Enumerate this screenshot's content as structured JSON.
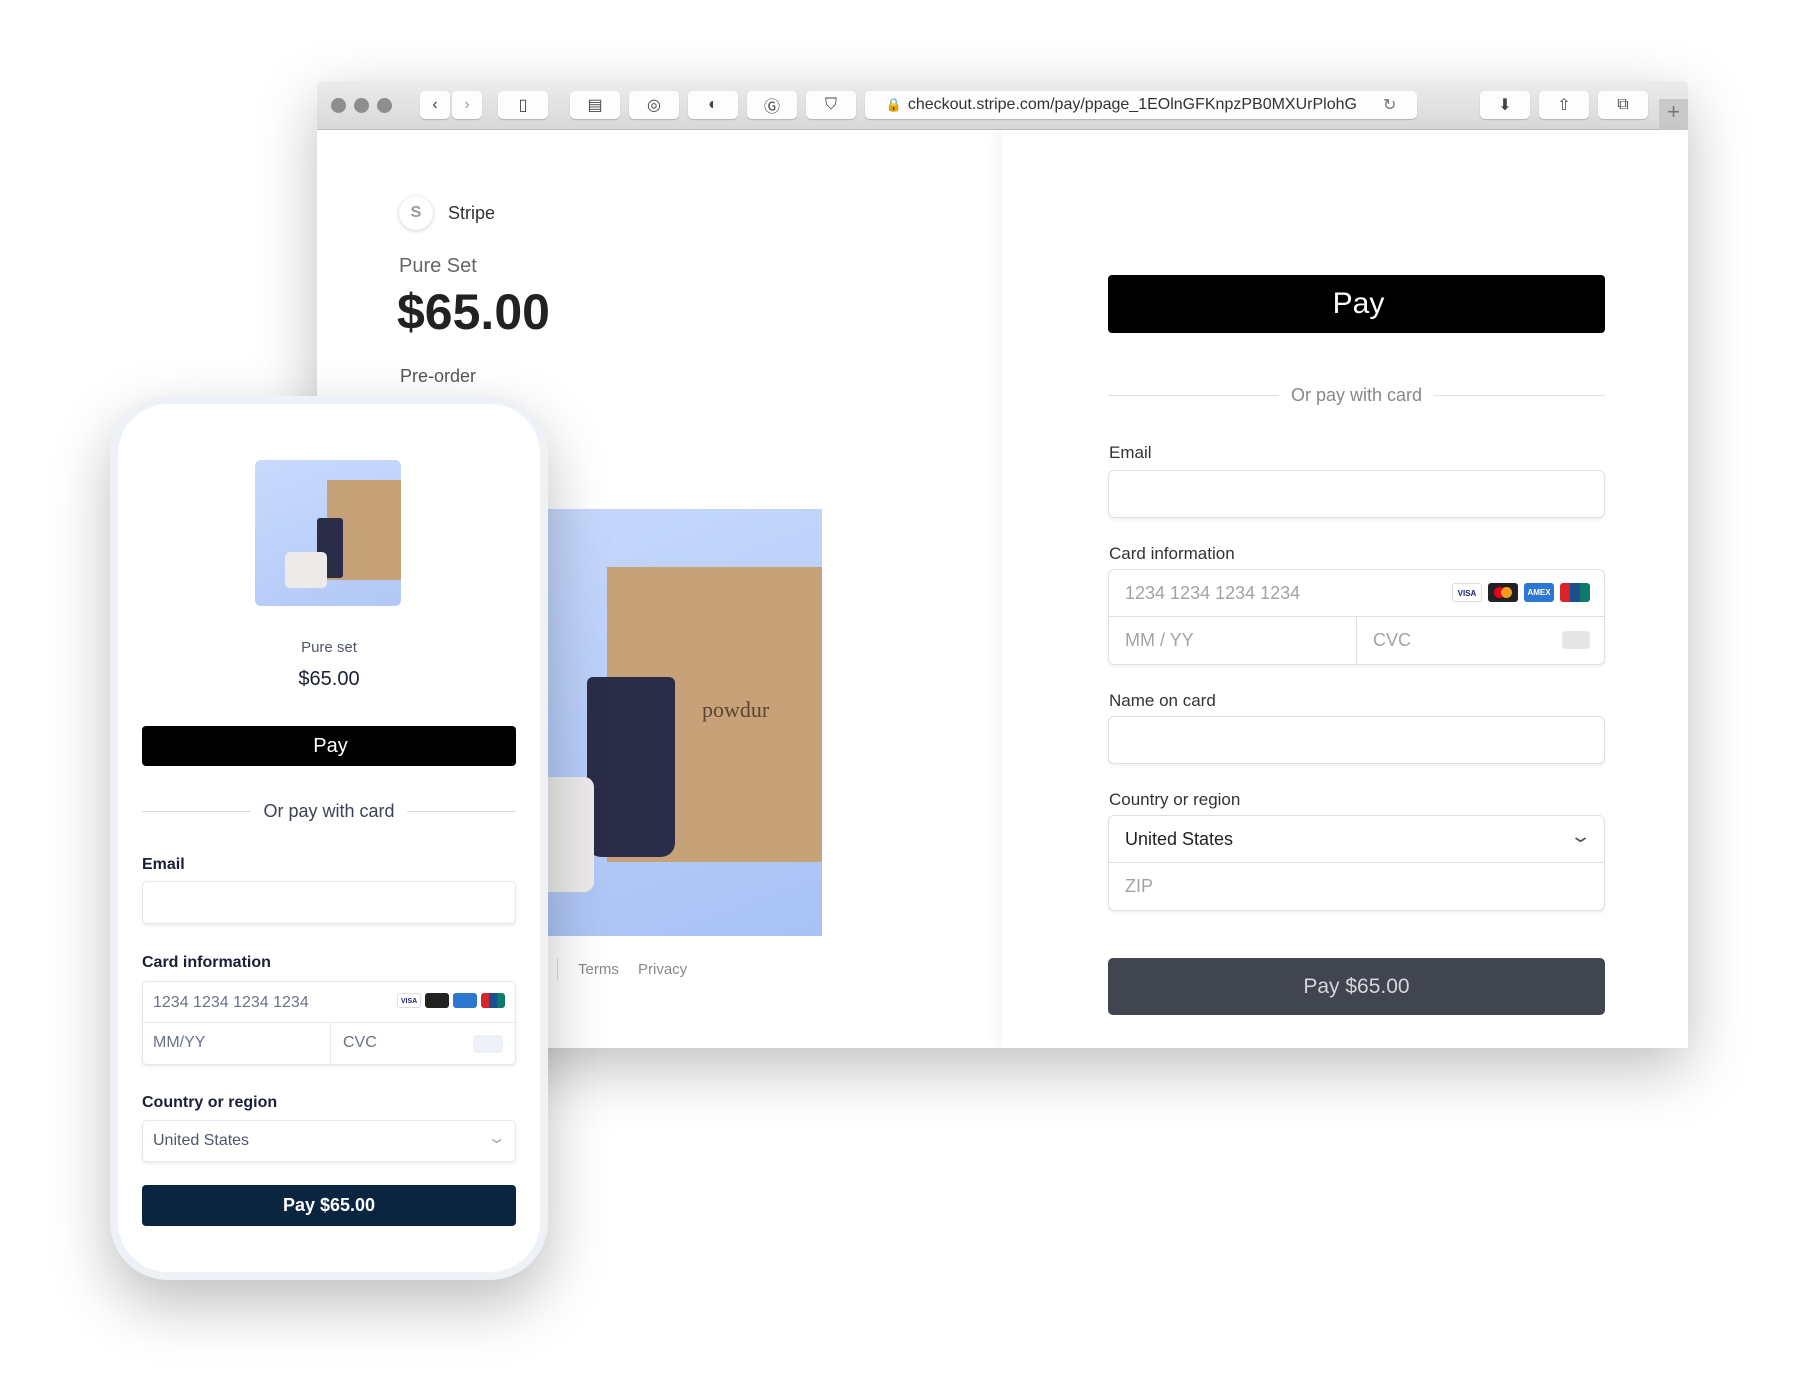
{
  "browser": {
    "url": "checkout.stripe.com/pay/ppage_1EOlnGFKnpzPB0MXUrPlohG",
    "toolbar_icons": [
      "back-icon",
      "forward-icon",
      "sidebar-icon",
      "extension-icon",
      "onepassword-icon",
      "toggle-icon",
      "grammarly-icon",
      "pocket-icon",
      "download-icon",
      "share-icon",
      "tabs-icon",
      "new-tab-icon"
    ]
  },
  "desktop": {
    "brand": "Stripe",
    "product_name": "Pure Set",
    "price": "$65.00",
    "subtitle": "Pre-order",
    "product_image_text": "powdur",
    "footer_links": [
      "Terms",
      "Privacy"
    ],
    "apple_pay_label": "Pay",
    "divider_text": "Or pay with card",
    "email_label": "Email",
    "card_label": "Card information",
    "card_number_placeholder": "1234 1234 1234 1234",
    "expiry_placeholder": "MM / YY",
    "cvc_placeholder": "CVC",
    "name_label": "Name on card",
    "country_label": "Country or region",
    "country_value": "United States",
    "zip_placeholder": "ZIP",
    "pay_button": "Pay $65.00",
    "card_brands": [
      "VISA",
      "Mastercard",
      "AMEX",
      "UnionPay"
    ]
  },
  "mobile": {
    "product_name": "Pure set",
    "price": "$65.00",
    "apple_pay_label": "Pay",
    "divider_text": "Or pay with card",
    "email_label": "Email",
    "card_label": "Card information",
    "card_number_placeholder": "1234 1234 1234 1234",
    "expiry_placeholder": "MM/YY",
    "cvc_placeholder": "CVC",
    "country_label": "Country or region",
    "country_value": "United States",
    "pay_button": "Pay $65.00"
  },
  "colors": {
    "accent_dark": "#0a2540",
    "pay_button_desktop": "#41454f",
    "product_bg": "#c5d7fb"
  }
}
